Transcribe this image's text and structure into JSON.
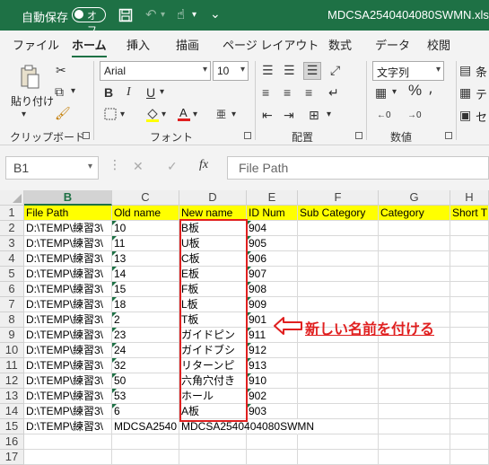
{
  "titlebar": {
    "autosave_label": "自動保存",
    "autosave_state": "オフ",
    "filename": "MDCSA2540404080SWMN.xls"
  },
  "menu": {
    "tabs": [
      "ファイル",
      "ホーム",
      "挿入",
      "描画",
      "ページ レイアウト",
      "数式",
      "データ",
      "校閲"
    ],
    "active": "ホーム"
  },
  "ribbon": {
    "paste_label": "貼り付け",
    "clipboard_label": "クリップボード",
    "font_label": "フォント",
    "alignment_label": "配置",
    "number_label": "数値",
    "font_name": "Arial",
    "font_size": "10",
    "number_format": "文字列",
    "bold": "B",
    "italic": "I",
    "underline": "U",
    "percent": "%",
    "cond_format_short": "条",
    "table_format_short": "テ",
    "cell_style_short": "セ"
  },
  "formula_bar": {
    "cell_ref": "B1",
    "value": "File Path",
    "fx": "fx"
  },
  "sheet": {
    "columns": [
      "B",
      "C",
      "D",
      "E",
      "F",
      "G",
      "H"
    ],
    "selected_column": "B",
    "headers": [
      "File Path",
      "Old name",
      "New name",
      "ID Num",
      "Sub Category",
      "Category",
      "Short T"
    ],
    "rows": [
      {
        "num": "2",
        "path": "D:\\TEMP\\練習3\\",
        "old": "10",
        "new": "B板",
        "id": "904"
      },
      {
        "num": "3",
        "path": "D:\\TEMP\\練習3\\",
        "old": "11",
        "new": "U板",
        "id": "905"
      },
      {
        "num": "4",
        "path": "D:\\TEMP\\練習3\\",
        "old": "13",
        "new": "C板",
        "id": "906"
      },
      {
        "num": "5",
        "path": "D:\\TEMP\\練習3\\",
        "old": "14",
        "new": "E板",
        "id": "907"
      },
      {
        "num": "6",
        "path": "D:\\TEMP\\練習3\\",
        "old": "15",
        "new": "F板",
        "id": "908"
      },
      {
        "num": "7",
        "path": "D:\\TEMP\\練習3\\",
        "old": "18",
        "new": "L板",
        "id": "909"
      },
      {
        "num": "8",
        "path": "D:\\TEMP\\練習3\\",
        "old": "2",
        "new": "T板",
        "id": "901"
      },
      {
        "num": "9",
        "path": "D:\\TEMP\\練習3\\",
        "old": "23",
        "new": "ガイドピン",
        "id": "911"
      },
      {
        "num": "10",
        "path": "D:\\TEMP\\練習3\\",
        "old": "24",
        "new": "ガイドブシ",
        "id": "912"
      },
      {
        "num": "11",
        "path": "D:\\TEMP\\練習3\\",
        "old": "32",
        "new": "リターンピ",
        "id": "913"
      },
      {
        "num": "12",
        "path": "D:\\TEMP\\練習3\\",
        "old": "50",
        "new": "六角穴付き",
        "id": "910"
      },
      {
        "num": "13",
        "path": "D:\\TEMP\\練習3\\",
        "old": "53",
        "new": "ホール",
        "id": "902"
      },
      {
        "num": "14",
        "path": "D:\\TEMP\\練習3\\",
        "old": "6",
        "new": "A板",
        "id": "903"
      }
    ],
    "row15": {
      "num": "15",
      "path": "D:\\TEMP\\練習3\\",
      "old": "MDCSA2540",
      "new": "MDCSA2540404080SWMN"
    },
    "extra_rows": [
      "16",
      "17"
    ]
  },
  "annotation": {
    "text": "新しい名前を付ける",
    "color": "#e02020"
  },
  "colors": {
    "accent": "#1e7145",
    "header_fill": "#ffff00"
  }
}
